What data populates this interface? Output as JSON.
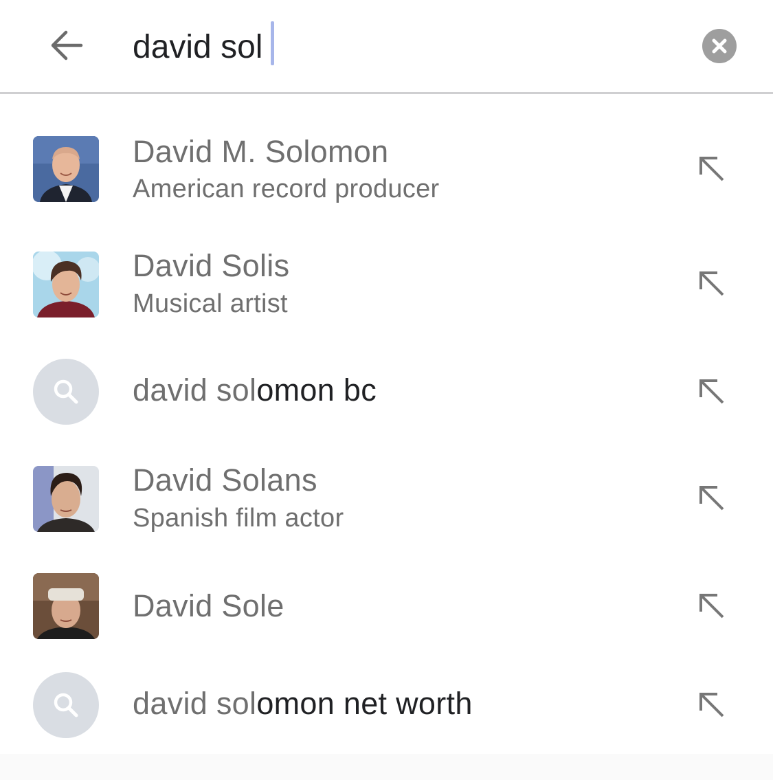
{
  "search": {
    "value": "david sol",
    "back_icon": "arrow-left-icon",
    "clear_icon": "close-circle-icon"
  },
  "suggestions": [
    {
      "type": "entity",
      "title": "David M. Solomon",
      "subtitle": "American record producer",
      "icon": "arrow-up-left-icon"
    },
    {
      "type": "entity",
      "title": "David Solis",
      "subtitle": "Musical artist",
      "icon": "arrow-up-left-icon"
    },
    {
      "type": "query",
      "prefix": "david sol",
      "suffix": "omon bc",
      "icon": "arrow-up-left-icon"
    },
    {
      "type": "entity",
      "title": "David Solans",
      "subtitle": "Spanish film actor",
      "icon": "arrow-up-left-icon"
    },
    {
      "type": "entity",
      "title": "David Sole",
      "icon": "arrow-up-left-icon"
    },
    {
      "type": "query",
      "prefix": "david sol",
      "suffix": "omon net worth",
      "icon": "arrow-up-left-icon"
    }
  ],
  "colors": {
    "text_primary": "#202124",
    "text_secondary": "#6f6f6f",
    "icon_gray": "#777777",
    "search_circle_bg": "#d9dde3"
  }
}
